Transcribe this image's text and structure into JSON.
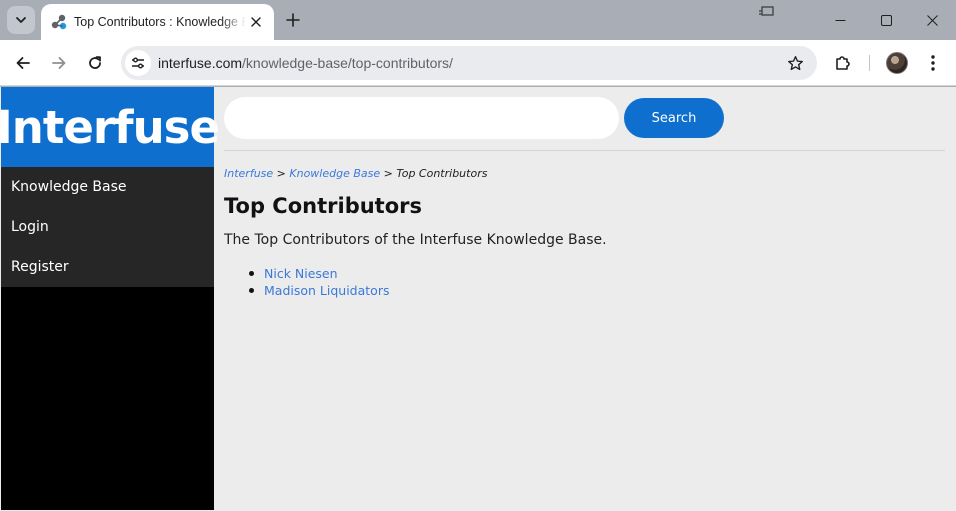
{
  "browser": {
    "tab": {
      "title": "Top Contributors : Knowledge Base"
    },
    "url": {
      "host": "interfuse.com",
      "path": "/knowledge-base/top-contributors/"
    }
  },
  "site": {
    "logo": "Interfuse",
    "nav": [
      "Knowledge Base",
      "Login",
      "Register"
    ],
    "search": {
      "placeholder": "",
      "button": "Search"
    },
    "breadcrumb": {
      "home": "Interfuse",
      "sep1": " > ",
      "section": "Knowledge Base",
      "sep2": " > ",
      "current": "Top Contributors"
    },
    "heading": "Top Contributors",
    "intro": "The Top Contributors of the Interfuse Knowledge Base.",
    "contributors": [
      "Nick Niesen",
      "Madison Liquidators"
    ]
  },
  "colors": {
    "brand": "#0f6fce",
    "link": "#3b79d8",
    "sidebar": "#000000",
    "nav_item": "#262626"
  }
}
